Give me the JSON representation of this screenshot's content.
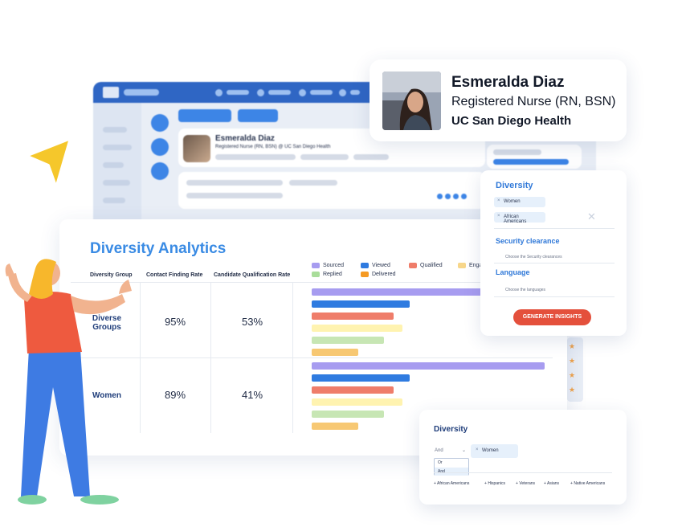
{
  "profile": {
    "name": "Esmeralda Diaz",
    "role": "Registered Nurse (RN, BSN)",
    "organization": "UC San Diego Health"
  },
  "background_app": {
    "name": "Esmeralda Diaz",
    "role": "Registered Nurse (RN, BSN) @ UC San Diego Health"
  },
  "analytics": {
    "title": "Diversity Analytics",
    "columns": [
      "Diversity Group",
      "Contact Finding Rate",
      "Candidate Qualification Rate"
    ],
    "rows": [
      {
        "group": "Diverse Groups",
        "contact_finding_rate": "95%",
        "candidate_qualification_rate": "53%"
      },
      {
        "group": "Women",
        "contact_finding_rate": "89%",
        "candidate_qualification_rate": "41%"
      }
    ],
    "legend": [
      {
        "label": "Sourced",
        "color": "#a79cf0"
      },
      {
        "label": "Viewed",
        "color": "#2f7be0"
      },
      {
        "label": "Qualified",
        "color": "#ef7d6a"
      },
      {
        "label": "Engaged",
        "color": "#f7d68a"
      },
      {
        "label": "Replied",
        "color": "#a9dd9a"
      },
      {
        "label": "Delivered",
        "color": "#f59a23"
      }
    ]
  },
  "chart_data": {
    "type": "bar",
    "categories": [
      "Diverse Groups",
      "Women"
    ],
    "series": [
      {
        "name": "Sourced",
        "values": [
          100,
          100
        ]
      },
      {
        "name": "Viewed",
        "values": [
          42,
          42
        ]
      },
      {
        "name": "Qualified",
        "values": [
          35,
          35
        ]
      },
      {
        "name": "Engaged",
        "values": [
          39,
          39
        ]
      },
      {
        "name": "Replied",
        "values": [
          31,
          31
        ]
      },
      {
        "name": "Delivered",
        "values": [
          20,
          20
        ]
      }
    ],
    "bar_colors": [
      "#a79cf0",
      "#2f7be0",
      "#ef7d6a",
      "#fff3b0",
      "#c7e6b4",
      "#f7c873"
    ]
  },
  "filter_panel": {
    "diversity_title": "Diversity",
    "tags": [
      "Women",
      "African Americans"
    ],
    "security_title": "Security clearance",
    "security_placeholder": "Choose the Security clearances",
    "language_title": "Language",
    "language_placeholder": "Choose the languages",
    "generate_label": "GENERATE INSIGHTS"
  },
  "diversity_card": {
    "title": "Diversity",
    "operator_selected": "And",
    "operator_options": [
      "Or",
      "And"
    ],
    "tag": "Women",
    "suggestions": [
      "African Americans",
      "Hispanics",
      "Veterans",
      "Asians",
      "Native Americans"
    ]
  },
  "colors": {
    "accent_blue": "#3a8be4",
    "brand_blue": "#2f66c4",
    "button_red": "#e4503c"
  }
}
